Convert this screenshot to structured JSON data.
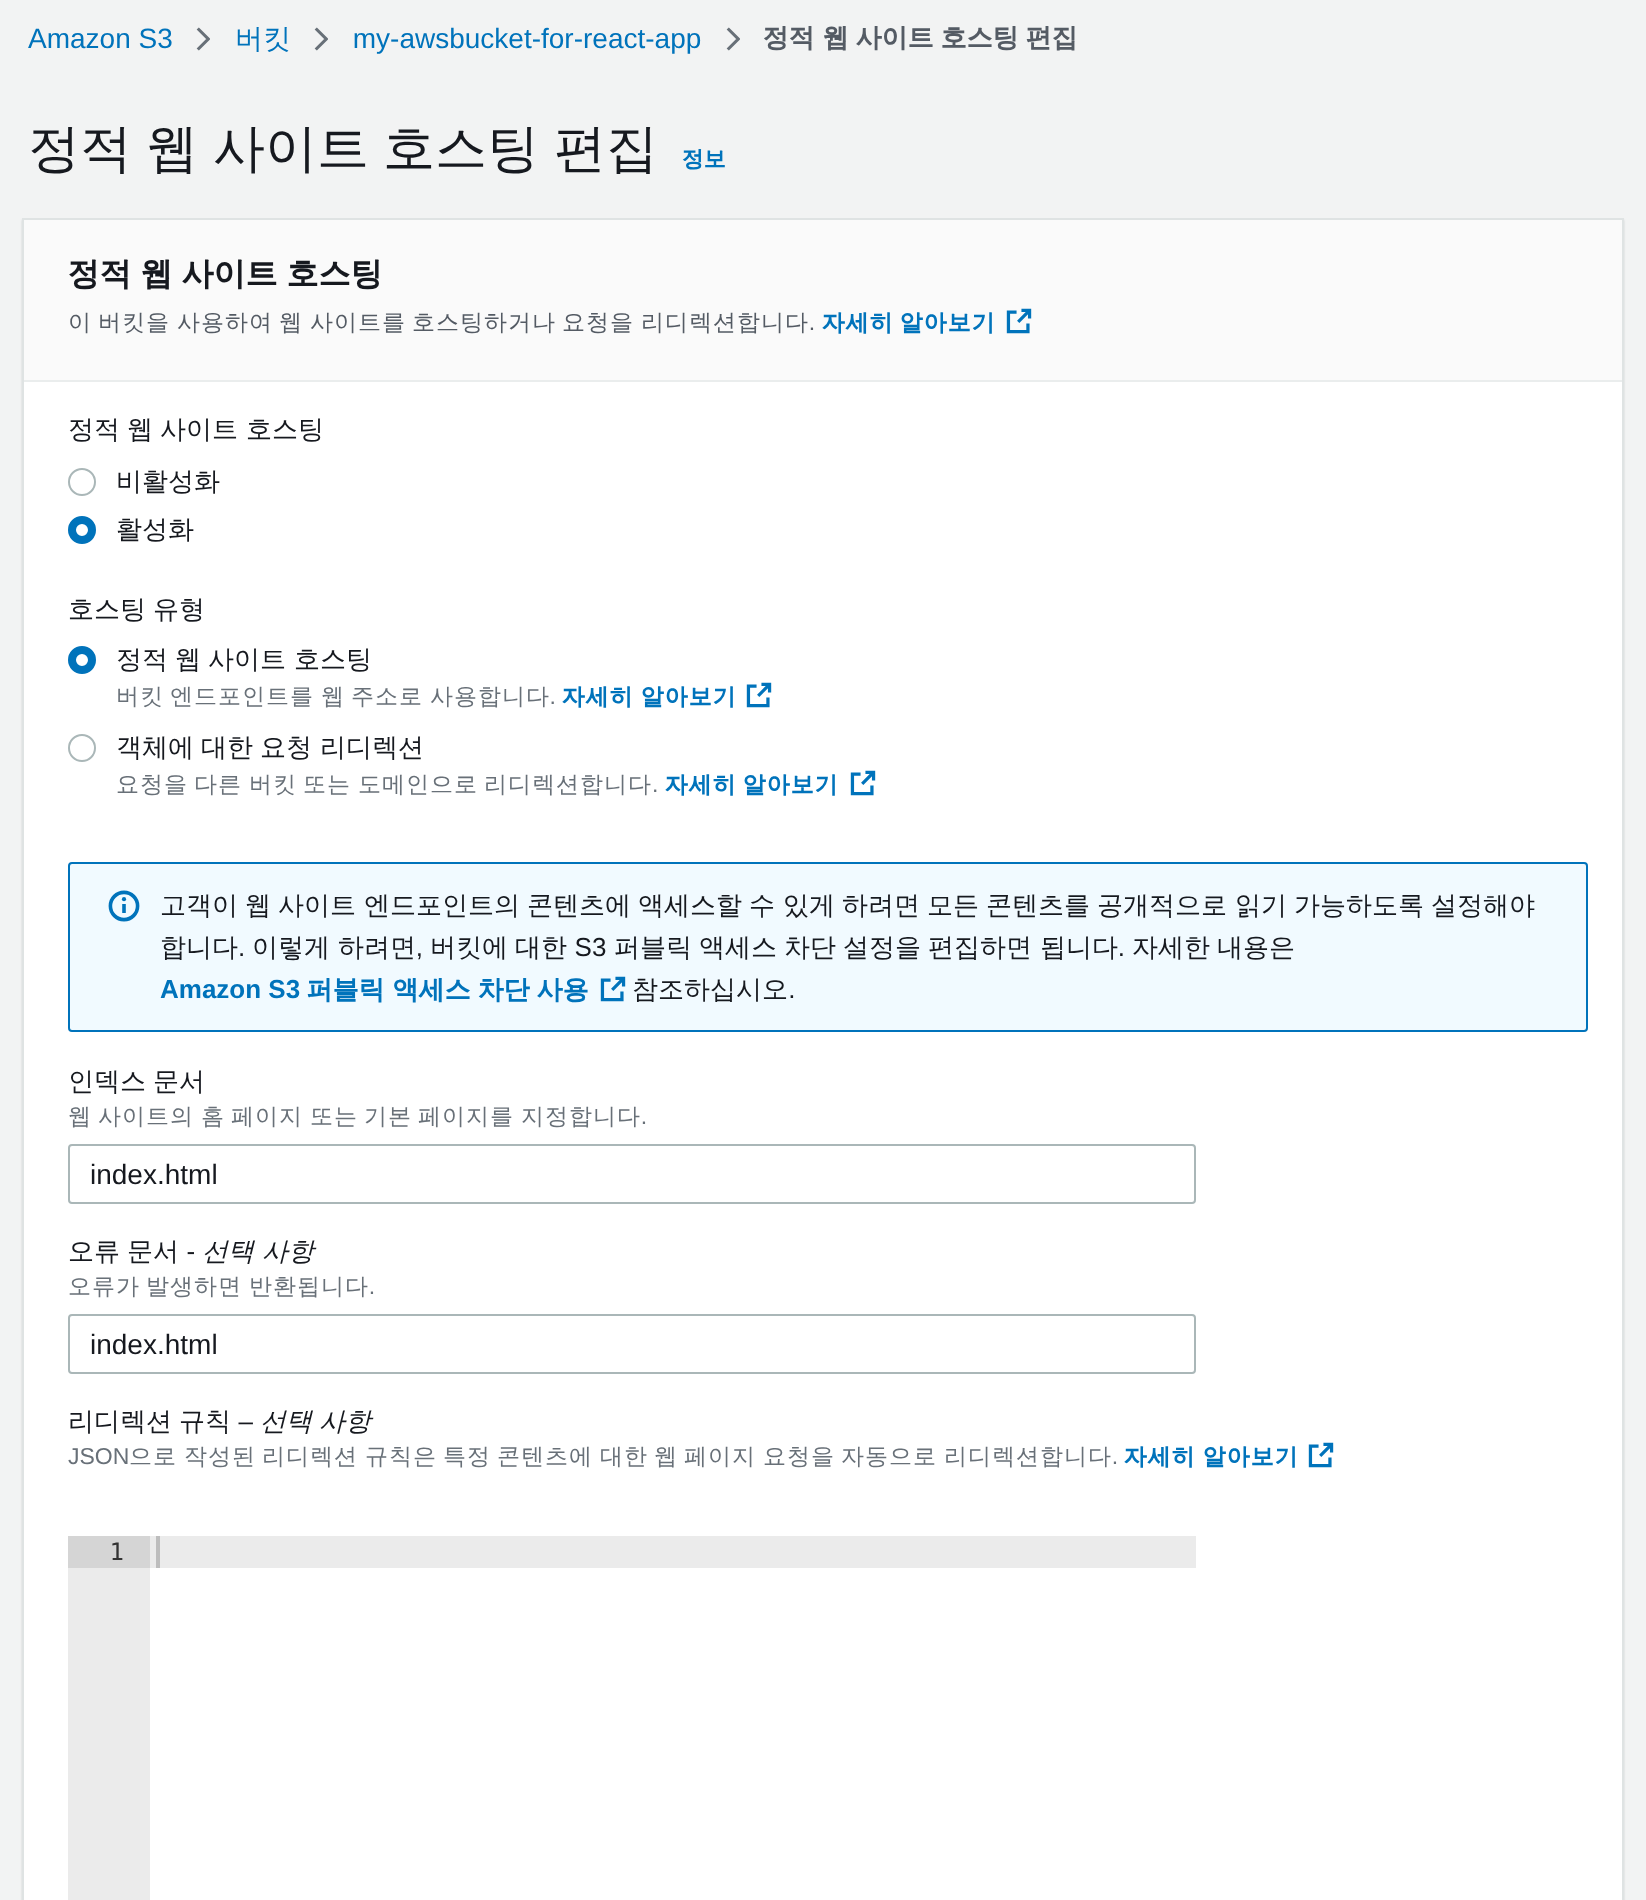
{
  "breadcrumbs": [
    {
      "label": "Amazon S3",
      "kind": "link"
    },
    {
      "label": "버킷",
      "kind": "link"
    },
    {
      "label": "my-awsbucket-for-react-app",
      "kind": "link"
    },
    {
      "label": "정적 웹 사이트 호스팅 편집",
      "kind": "current"
    }
  ],
  "page_header": {
    "title": "정적 웹 사이트 호스팅 편집",
    "info_link": "정보"
  },
  "panel": {
    "title": "정적 웹 사이트 호스팅",
    "description": "이 버킷을 사용하여 웹 사이트를 호스팅하거나 요청을 리디렉션합니다.",
    "learn_more": "자세히 알아보기"
  },
  "static_hosting": {
    "label": "정적 웹 사이트 호스팅",
    "options": [
      {
        "label": "비활성화",
        "selected": false
      },
      {
        "label": "활성화",
        "selected": true
      }
    ]
  },
  "hosting_type": {
    "label": "호스팅 유형",
    "options": [
      {
        "label": "정적 웹 사이트 호스팅",
        "description": "버킷 엔드포인트를 웹 주소로 사용합니다.",
        "learn_more": "자세히 알아보기",
        "selected": true
      },
      {
        "label": "객체에 대한 요청 리디렉션",
        "description": "요청을 다른 버킷 또는 도메인으로 리디렉션합니다.",
        "learn_more": "자세히 알아보기",
        "selected": false
      }
    ]
  },
  "info_alert": {
    "text": "고객이 웹 사이트 엔드포인트의 콘텐츠에 액세스할 수 있게 하려면 모든 콘텐츠를 공개적으로 읽기 가능하도록 설정해야 합니다. 이렇게 하려면, 버킷에 대한 S3 퍼블릭 액세스 차단 설정을 편집하면 됩니다. 자세한 내용은",
    "link": "Amazon S3 퍼블릭 액세스 차단 사용",
    "suffix": "참조하십시오."
  },
  "index_document": {
    "label": "인덱스 문서",
    "description": "웹 사이트의 홈 페이지 또는 기본 페이지를 지정합니다.",
    "value": "index.html"
  },
  "error_document": {
    "label": "오류 문서 - *선택 사항*",
    "description": "오류가 발생하면 반환됩니다.",
    "value": "index.html"
  },
  "redirection_rules": {
    "label": "리디렉션 규칙 – *선택 사항*",
    "description": "JSON으로 작성된 리디렉션 규칙은 특정 콘텐츠에 대한 웹 페이지 요청을 자동으로 리디렉션합니다.",
    "learn_more": "자세히 알아보기",
    "editor": {
      "line_numbers": [
        "1"
      ]
    }
  }
}
